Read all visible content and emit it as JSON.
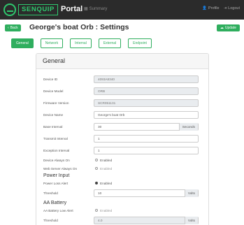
{
  "header": {
    "brand": "SENQUIP",
    "portal": "Portal",
    "summary_label": "Summary",
    "profile_label": "Profile",
    "logout_label": "Logout"
  },
  "page": {
    "back_label": "Back",
    "title": "George's boat Orb : Settings",
    "update_label": "Update"
  },
  "tabs": [
    {
      "label": "General",
      "active": true
    },
    {
      "label": "Network",
      "active": false
    },
    {
      "label": "Internal",
      "active": false
    },
    {
      "label": "External",
      "active": false
    },
    {
      "label": "Endpoint",
      "active": false
    }
  ],
  "general": {
    "heading": "General",
    "device_id": {
      "label": "Device ID",
      "value": "4093A8340"
    },
    "device_model": {
      "label": "Device Model",
      "value": "ORB"
    },
    "firmware": {
      "label": "Firmware Version",
      "value": "SCR051131"
    },
    "device_name": {
      "label": "Device Name",
      "value": "George's boat Orb"
    },
    "base_interval": {
      "label": "Base Interval",
      "value": "30",
      "unit": "Seconds"
    },
    "transmit_interval": {
      "label": "Transmit Interval",
      "value": "1"
    },
    "exception_interval": {
      "label": "Exception Interval",
      "value": "1"
    },
    "always_on": {
      "label": "Device Always On",
      "option": "Enabled"
    },
    "web_server": {
      "label": "Web Server Always On",
      "option": "Enabled"
    }
  },
  "power": {
    "heading": "Power Input",
    "loss_alert": {
      "label": "Power Loss Alert",
      "option": "Enabled"
    },
    "threshold": {
      "label": "Threshold",
      "value": "10",
      "unit": "Volts"
    }
  },
  "battery": {
    "heading": "AA Battery",
    "low_alert": {
      "label": "AA Battery Low Alert",
      "option": "Enabled"
    },
    "threshold": {
      "label": "Threshold",
      "value": "4.0",
      "unit": "Volts"
    }
  }
}
